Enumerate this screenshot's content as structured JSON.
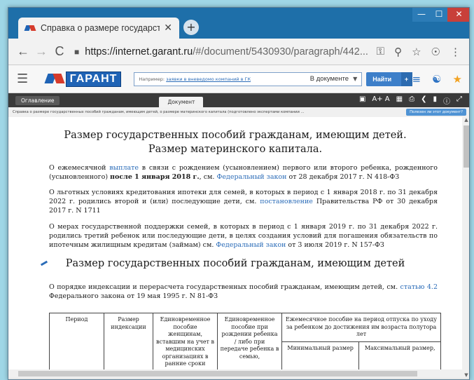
{
  "tab": {
    "title": "Справка о размере государстве",
    "close": "✕",
    "new_tab": "+"
  },
  "window_controls": {
    "minimize": "—",
    "maximize": "☐",
    "close": "✕"
  },
  "address": {
    "back": "←",
    "forward": "→",
    "reload": "C",
    "lock": "🔒",
    "host": "https://internet.garant.ru",
    "path": "/#/document/5430930/paragraph/442..."
  },
  "garant": {
    "logo_text": "ГАРАНТ",
    "search_placeholder_prefix": "Например: ",
    "search_placeholder_link": "заявки в вневедомо компаний в ГК",
    "search_scope": "В документе",
    "find_label": "Найти"
  },
  "subbar": {
    "toc": "Оглавление",
    "doc": "Документ",
    "font": "A+ A"
  },
  "breadcrumb": {
    "text": "Справка о размере государственных пособий гражданам, имеющим детей, о размере материнского капитала (подготовлено экспертами компании ...",
    "ask": "Полезен ли этот документ?"
  },
  "document": {
    "title_line1": "Размер государственных пособий гражданам, имеющим детей.",
    "title_line2": "Размер материнского капитала.",
    "p1": {
      "t1": "О ежемесячной ",
      "link1": "выплате",
      "t2": " в связи с рождением (усыновлением) первого или второго ребенка, рожденного (усыновленного) ",
      "bold": "после 1 января 2018 г.",
      "t3": ", см. ",
      "link2": "Федеральный закон",
      "t4": " от 28 декабря 2017 г. N 418-ФЗ"
    },
    "p2": {
      "t1": "О льготных условиях кредитования ипотеки для семей, в которых в период с 1 января 2018 г. по 31 декабря 2022 г. родились второй и (или) последующие дети, см. ",
      "link1": "постановление",
      "t2": " Правительства РФ от 30 декабря 2017 г. N 1711"
    },
    "p3": {
      "t1": "О мерах государственной поддержки семей, в которых в период с 1 января 2019 г. по 31 декабря 2022 г. родились третий ребенок или последующие дети, в целях создания условий для погашения обязательств по ипотечным жилищным кредитам (займам) см. ",
      "link1": "Федеральный закон",
      "t2": " от 3 июля 2019 г. N 157-ФЗ"
    },
    "section_title": "Размер государственных пособий гражданам, имеющим детей",
    "p4": {
      "t1": "О порядке индексации и перерасчета государственных пособий гражданам, имеющим детей, см. ",
      "link1": "статью 4.2",
      "t2": " Федерального закона от 19 мая 1995 г. N 81-ФЗ"
    },
    "table": {
      "period": "Период",
      "index": "Размер индексации",
      "one_link": "Единовременное пособие",
      "one_text": " женщинам, вставшим на учет в медицинских организациях в ранние сроки",
      "two_link": "Единовременное пособие",
      "two_text": " при рождении ребенка / либо при передаче ребенка в семью,",
      "monthly_link": "Ежемесячное пособие",
      "monthly_text": " на период отпуска по уходу за ребенком до достижения им возраста полутора лет",
      "min": "Минимальный размер",
      "max": "Максимальный размер,"
    }
  }
}
